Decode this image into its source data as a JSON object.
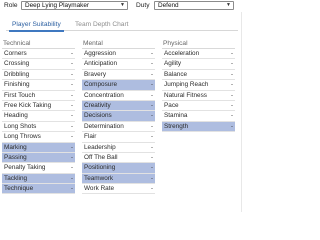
{
  "header": {
    "role_label": "Role",
    "role_value": "Deep Lying Playmaker",
    "duty_label": "Duty",
    "duty_value": "Defend"
  },
  "tabs": [
    {
      "label": "Player Suitability",
      "active": true
    },
    {
      "label": "Team Depth Chart",
      "active": false
    }
  ],
  "columns": [
    {
      "title": "Technical",
      "rows": [
        {
          "label": "Corners",
          "value": "-",
          "highlight": false
        },
        {
          "label": "Crossing",
          "value": "-",
          "highlight": false
        },
        {
          "label": "Dribbling",
          "value": "-",
          "highlight": false
        },
        {
          "label": "Finishing",
          "value": "-",
          "highlight": false
        },
        {
          "label": "First Touch",
          "value": "-",
          "highlight": false
        },
        {
          "label": "Free Kick Taking",
          "value": "-",
          "highlight": false
        },
        {
          "label": "Heading",
          "value": "-",
          "highlight": false
        },
        {
          "label": "Long Shots",
          "value": "-",
          "highlight": false
        },
        {
          "label": "Long Throws",
          "value": "-",
          "highlight": false
        },
        {
          "label": "Marking",
          "value": "-",
          "highlight": true
        },
        {
          "label": "Passing",
          "value": "-",
          "highlight": true
        },
        {
          "label": "Penalty Taking",
          "value": "-",
          "highlight": false
        },
        {
          "label": "Tackling",
          "value": "-",
          "highlight": true
        },
        {
          "label": "Technique",
          "value": "-",
          "highlight": true
        }
      ]
    },
    {
      "title": "Mental",
      "rows": [
        {
          "label": "Aggression",
          "value": "-",
          "highlight": false
        },
        {
          "label": "Anticipation",
          "value": "-",
          "highlight": false
        },
        {
          "label": "Bravery",
          "value": "-",
          "highlight": false
        },
        {
          "label": "Composure",
          "value": "-",
          "highlight": true
        },
        {
          "label": "Concentration",
          "value": "-",
          "highlight": false
        },
        {
          "label": "Creativity",
          "value": "-",
          "highlight": true
        },
        {
          "label": "Decisions",
          "value": "-",
          "highlight": true
        },
        {
          "label": "Determination",
          "value": "-",
          "highlight": false
        },
        {
          "label": "Flair",
          "value": "-",
          "highlight": false
        },
        {
          "label": "Leadership",
          "value": "-",
          "highlight": false
        },
        {
          "label": "Off The Ball",
          "value": "-",
          "highlight": false
        },
        {
          "label": "Positioning",
          "value": "-",
          "highlight": true
        },
        {
          "label": "Teamwork",
          "value": "-",
          "highlight": true
        },
        {
          "label": "Work Rate",
          "value": "-",
          "highlight": false
        }
      ]
    },
    {
      "title": "Physical",
      "rows": [
        {
          "label": "Acceleration",
          "value": "-",
          "highlight": false
        },
        {
          "label": "Agility",
          "value": "-",
          "highlight": false
        },
        {
          "label": "Balance",
          "value": "-",
          "highlight": false
        },
        {
          "label": "Jumping Reach",
          "value": "-",
          "highlight": false
        },
        {
          "label": "Natural Fitness",
          "value": "-",
          "highlight": false
        },
        {
          "label": "Pace",
          "value": "-",
          "highlight": false
        },
        {
          "label": "Stamina",
          "value": "-",
          "highlight": false
        },
        {
          "label": "Strength",
          "value": "-",
          "highlight": true
        }
      ]
    }
  ],
  "colors": {
    "highlight_row": "#aebde0",
    "active_tab": "#2b5fa0"
  }
}
